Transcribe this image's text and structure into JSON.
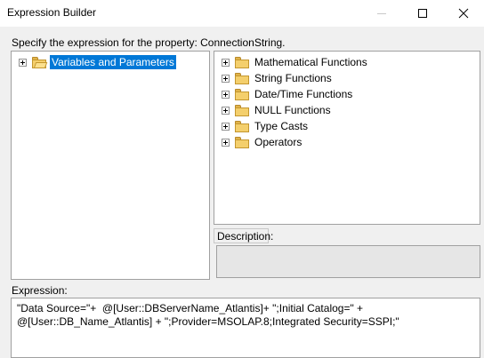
{
  "window": {
    "title": "Expression Builder"
  },
  "prompt": "Specify the expression for the property: ConnectionString.",
  "left_tree": {
    "items": [
      {
        "label": "Variables and Parameters",
        "selected": true
      }
    ]
  },
  "right_tree": {
    "items": [
      {
        "label": "Mathematical Functions"
      },
      {
        "label": "String Functions"
      },
      {
        "label": "Date/Time Functions"
      },
      {
        "label": "NULL Functions"
      },
      {
        "label": "Type Casts"
      },
      {
        "label": "Operators"
      }
    ]
  },
  "description": {
    "label": "Description:",
    "value": ""
  },
  "expression": {
    "label": "Expression:",
    "value": "\"Data Source=\"+  @[User::DBServerName_Atlantis]+ \";Initial Catalog=\" + @[User::DB_Name_Atlantis] + \";Provider=MSOLAP.8;Integrated Security=SSPI;\""
  },
  "colors": {
    "selection": "#0078d7",
    "folder": "#f4cf6c",
    "background": "#f0f0f0"
  }
}
